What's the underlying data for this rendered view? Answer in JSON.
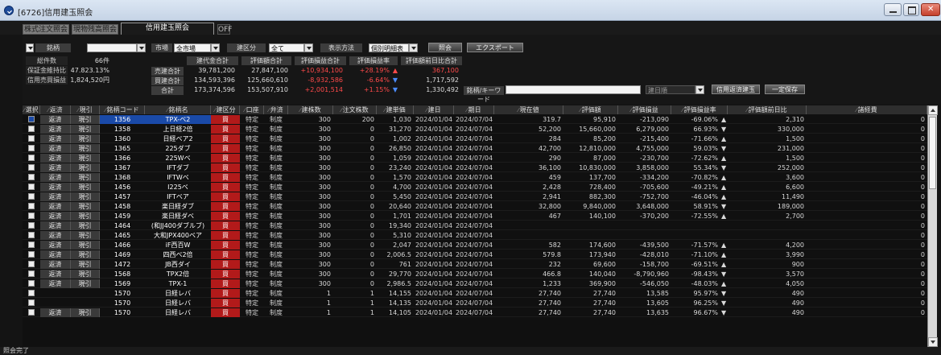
{
  "window": {
    "title": "[6726]信用建玉照会"
  },
  "tabs": [
    {
      "label": "株式注文照会"
    },
    {
      "label": "現物残高照会"
    },
    {
      "label": "信用建玉照会"
    },
    {
      "label": "OFF"
    }
  ],
  "filters": {
    "meigara_label": "銘柄",
    "meigara_value": "",
    "shijo_label": "市場",
    "shijo_value": "全市場",
    "tatekubun_label": "建区分",
    "tatekubun_value": "全て",
    "hyoji_label": "表示方法",
    "hyoji_value": "個別明細表示",
    "shokai_button": "照会",
    "export_button": "エクスポート"
  },
  "summary": {
    "rows": [
      {
        "label": "総件数",
        "value": "66件"
      },
      {
        "label": "保証金維持比率",
        "value": "47.823.13%"
      },
      {
        "label": "信用売買損益",
        "value": "1,824,520円"
      }
    ],
    "headers": [
      "建代金合計",
      "評価額合計",
      "評価損益合計",
      "評価損益率",
      "評価額前日比合計"
    ],
    "lines": [
      {
        "label": "売建合計",
        "values": [
          "39,781,200",
          "27,847,100",
          "+10,934,100",
          "+28.19%",
          "367,100"
        ],
        "arrow": "up"
      },
      {
        "label": "買建合計",
        "values": [
          "134,593,396",
          "125,660,610",
          "-8,932,586",
          "-6.64%",
          "1,717,592"
        ],
        "arrow": "down"
      },
      {
        "label": "合計",
        "values": [
          "173,374,596",
          "153,507,910",
          "+2,001,514",
          "+1.15%",
          "1,330,492"
        ],
        "arrow": "down"
      }
    ],
    "keyword_label": "銘柄/キーワード",
    "keyword_value": "",
    "date_value": "建日順",
    "order_btn": "信用返済建玉",
    "hold_btn": "一定保存"
  },
  "columns": [
    "選択",
    "返済",
    "現引",
    "銘柄コード",
    "銘柄名",
    "建区分",
    "口座",
    "弁済",
    "建株数",
    "注文株数",
    "建単価",
    "建日",
    "期日",
    "現在値",
    "評価額",
    "評価損益",
    "評価損益率",
    "評価額前日比",
    "諸経費"
  ],
  "rows": [
    {
      "sel": true,
      "act1": "返済",
      "act2": "現引",
      "code": "1356",
      "name": "TPX-ベ2",
      "kubun": "買",
      "koza": "特定",
      "bensai": "制度",
      "qty": "300",
      "order": "200",
      "price": "1,030",
      "date": "2024/01/04",
      "due": "2024/07/04",
      "cur": "319.7",
      "eval": "95,910",
      "pl": "-213,090",
      "plr": "-69.06%",
      "arrow": "up",
      "dod": "2,310",
      "fee": "0",
      "neg": true
    },
    {
      "sel": false,
      "act1": "返済",
      "act2": "現引",
      "code": "1358",
      "name": "上日経2倍",
      "kubun": "買",
      "koza": "特定",
      "bensai": "制度",
      "qty": "300",
      "order": "0",
      "price": "31,270",
      "date": "2024/01/04",
      "due": "2024/07/04",
      "cur": "52,200",
      "eval": "15,660,000",
      "pl": "6,279,000",
      "plr": "66.93%",
      "arrow": "down",
      "dod": "330,000",
      "fee": "0",
      "neg": false
    },
    {
      "sel": false,
      "act1": "返済",
      "act2": "現引",
      "code": "1360",
      "name": "日経ベア2",
      "kubun": "買",
      "koza": "特定",
      "bensai": "制度",
      "qty": "300",
      "order": "0",
      "price": "1,002",
      "date": "2024/01/04",
      "due": "2024/07/04",
      "cur": "284",
      "eval": "85,200",
      "pl": "-215,400",
      "plr": "-71.66%",
      "arrow": "up",
      "dod": "1,500",
      "fee": "0",
      "neg": true
    },
    {
      "sel": false,
      "act1": "返済",
      "act2": "現引",
      "code": "1365",
      "name": "225ダブ",
      "kubun": "買",
      "koza": "特定",
      "bensai": "制度",
      "qty": "300",
      "order": "0",
      "price": "26,850",
      "date": "2024/01/04",
      "due": "2024/07/04",
      "cur": "42,700",
      "eval": "12,810,000",
      "pl": "4,755,000",
      "plr": "59.03%",
      "arrow": "down",
      "dod": "231,000",
      "fee": "0",
      "neg": false
    },
    {
      "sel": false,
      "act1": "返済",
      "act2": "現引",
      "code": "1366",
      "name": "225Wベ",
      "kubun": "買",
      "koza": "特定",
      "bensai": "制度",
      "qty": "300",
      "order": "0",
      "price": "1,059",
      "date": "2024/01/04",
      "due": "2024/07/04",
      "cur": "290",
      "eval": "87,000",
      "pl": "-230,700",
      "plr": "-72.62%",
      "arrow": "up",
      "dod": "1,500",
      "fee": "0",
      "neg": true
    },
    {
      "sel": false,
      "act1": "返済",
      "act2": "現引",
      "code": "1367",
      "name": "IFTダブ",
      "kubun": "買",
      "koza": "特定",
      "bensai": "制度",
      "qty": "300",
      "order": "0",
      "price": "23,240",
      "date": "2024/01/04",
      "due": "2024/07/04",
      "cur": "36,100",
      "eval": "10,830,000",
      "pl": "3,858,000",
      "plr": "55.34%",
      "arrow": "down",
      "dod": "252,000",
      "fee": "0",
      "neg": false
    },
    {
      "sel": false,
      "act1": "返済",
      "act2": "現引",
      "code": "1368",
      "name": "IFTWベ",
      "kubun": "買",
      "koza": "特定",
      "bensai": "制度",
      "qty": "300",
      "order": "0",
      "price": "1,570",
      "date": "2024/01/04",
      "due": "2024/07/04",
      "cur": "459",
      "eval": "137,700",
      "pl": "-334,200",
      "plr": "-70.82%",
      "arrow": "up",
      "dod": "3,600",
      "fee": "0",
      "neg": true
    },
    {
      "sel": false,
      "act1": "返済",
      "act2": "現引",
      "code": "1456",
      "name": "I225ベ",
      "kubun": "買",
      "koza": "特定",
      "bensai": "制度",
      "qty": "300",
      "order": "0",
      "price": "4,700",
      "date": "2024/01/04",
      "due": "2024/07/04",
      "cur": "2,428",
      "eval": "728,400",
      "pl": "-705,600",
      "plr": "-49.21%",
      "arrow": "up",
      "dod": "6,600",
      "fee": "0",
      "neg": true
    },
    {
      "sel": false,
      "act1": "返済",
      "act2": "現引",
      "code": "1457",
      "name": "IFTベア",
      "kubun": "買",
      "koza": "特定",
      "bensai": "制度",
      "qty": "300",
      "order": "0",
      "price": "5,450",
      "date": "2024/01/04",
      "due": "2024/07/04",
      "cur": "2,941",
      "eval": "882,300",
      "pl": "-752,700",
      "plr": "-46.04%",
      "arrow": "up",
      "dod": "11,490",
      "fee": "0",
      "neg": true
    },
    {
      "sel": false,
      "act1": "返済",
      "act2": "現引",
      "code": "1458",
      "name": "楽日経ダブ",
      "kubun": "買",
      "koza": "特定",
      "bensai": "制度",
      "qty": "300",
      "order": "0",
      "price": "20,640",
      "date": "2024/01/04",
      "due": "2024/07/04",
      "cur": "32,800",
      "eval": "9,840,000",
      "pl": "3,648,000",
      "plr": "58.91%",
      "arrow": "down",
      "dod": "189,000",
      "fee": "0",
      "neg": false
    },
    {
      "sel": false,
      "act1": "返済",
      "act2": "現引",
      "code": "1459",
      "name": "楽日経ダベ",
      "kubun": "買",
      "koza": "特定",
      "bensai": "制度",
      "qty": "300",
      "order": "0",
      "price": "1,701",
      "date": "2024/01/04",
      "due": "2024/07/04",
      "cur": "467",
      "eval": "140,100",
      "pl": "-370,200",
      "plr": "-72.55%",
      "arrow": "up",
      "dod": "2,700",
      "fee": "0",
      "neg": true
    },
    {
      "sel": false,
      "act1": "返済",
      "act2": "現引",
      "code": "1464",
      "name": "(和JJ400ダブルブ)",
      "kubun": "買",
      "koza": "特定",
      "bensai": "制度",
      "qty": "300",
      "order": "0",
      "price": "19,340",
      "date": "2024/01/04",
      "due": "2024/07/04",
      "cur": "",
      "eval": "",
      "pl": "",
      "plr": "",
      "arrow": "",
      "dod": "",
      "fee": "0",
      "neg": false
    },
    {
      "sel": false,
      "act1": "返済",
      "act2": "現引",
      "code": "1465",
      "name": "大和JPX400ベア",
      "kubun": "買",
      "koza": "特定",
      "bensai": "制度",
      "qty": "300",
      "order": "0",
      "price": "5,310",
      "date": "2024/01/04",
      "due": "2024/07/04",
      "cur": "",
      "eval": "",
      "pl": "",
      "plr": "",
      "arrow": "",
      "dod": "",
      "fee": "0",
      "neg": false
    },
    {
      "sel": false,
      "act1": "返済",
      "act2": "現引",
      "code": "1466",
      "name": "iF西百W",
      "kubun": "買",
      "koza": "特定",
      "bensai": "制度",
      "qty": "300",
      "order": "0",
      "price": "2,047",
      "date": "2024/01/04",
      "due": "2024/07/04",
      "cur": "582",
      "eval": "174,600",
      "pl": "-439,500",
      "plr": "-71.57%",
      "arrow": "up",
      "dod": "4,200",
      "fee": "0",
      "neg": true
    },
    {
      "sel": false,
      "act1": "返済",
      "act2": "現引",
      "code": "1469",
      "name": "四西ベ2倍",
      "kubun": "買",
      "koza": "特定",
      "bensai": "制度",
      "qty": "300",
      "order": "0",
      "price": "2,006.5",
      "date": "2024/01/04",
      "due": "2024/07/04",
      "cur": "579.8",
      "eval": "173,940",
      "pl": "-428,010",
      "plr": "-71.10%",
      "arrow": "up",
      "dod": "3,990",
      "fee": "0",
      "neg": true
    },
    {
      "sel": false,
      "act1": "返済",
      "act2": "現引",
      "code": "1472",
      "name": "JB西ダイ",
      "kubun": "買",
      "koza": "特定",
      "bensai": "制度",
      "qty": "300",
      "order": "0",
      "price": "761",
      "date": "2024/01/04",
      "due": "2024/07/04",
      "cur": "232",
      "eval": "69,600",
      "pl": "-158,700",
      "plr": "-69.51%",
      "arrow": "up",
      "dod": "900",
      "fee": "0",
      "neg": true
    },
    {
      "sel": false,
      "act1": "返済",
      "act2": "現引",
      "code": "1568",
      "name": "TPX2倍",
      "kubun": "買",
      "koza": "特定",
      "bensai": "制度",
      "qty": "300",
      "order": "0",
      "price": "29,770",
      "date": "2024/01/04",
      "due": "2024/07/04",
      "cur": "466.8",
      "eval": "140,040",
      "pl": "-8,790,960",
      "plr": "-98.43%",
      "arrow": "down",
      "dod": "3,570",
      "fee": "0",
      "neg": true
    },
    {
      "sel": false,
      "act1": "返済",
      "act2": "現引",
      "code": "1569",
      "name": "TPX-1",
      "kubun": "買",
      "koza": "特定",
      "bensai": "制度",
      "qty": "300",
      "order": "0",
      "price": "2,986.5",
      "date": "2024/01/04",
      "due": "2024/07/04",
      "cur": "1,233",
      "eval": "369,900",
      "pl": "-546,050",
      "plr": "-48.03%",
      "arrow": "up",
      "dod": "4,050",
      "fee": "0",
      "neg": true
    },
    {
      "sel": false,
      "act1": "",
      "act2": "",
      "code": "1570",
      "name": "日経レバ",
      "kubun": "買",
      "koza": "特定",
      "bensai": "制度",
      "qty": "1",
      "order": "1",
      "price": "14,155",
      "date": "2024/01/04",
      "due": "2024/07/04",
      "cur": "27,740",
      "eval": "27,740",
      "pl": "13,585",
      "plr": "95.97%",
      "arrow": "down",
      "dod": "490",
      "fee": "0",
      "neg": false
    },
    {
      "sel": false,
      "act1": "",
      "act2": "",
      "code": "1570",
      "name": "日経レバ",
      "kubun": "買",
      "koza": "特定",
      "bensai": "制度",
      "qty": "1",
      "order": "1",
      "price": "14,135",
      "date": "2024/01/04",
      "due": "2024/07/04",
      "cur": "27,740",
      "eval": "27,740",
      "pl": "13,605",
      "plr": "96.25%",
      "arrow": "down",
      "dod": "490",
      "fee": "0",
      "neg": false
    },
    {
      "sel": false,
      "act1": "返済",
      "act2": "現引",
      "code": "1570",
      "name": "日経レバ",
      "kubun": "買",
      "koza": "特定",
      "bensai": "制度",
      "qty": "1",
      "order": "1",
      "price": "14,105",
      "date": "2024/01/04",
      "due": "2024/07/04",
      "cur": "27,740",
      "eval": "27,740",
      "pl": "13,635",
      "plr": "96.67%",
      "arrow": "down",
      "dod": "490",
      "fee": "0",
      "neg": false
    }
  ],
  "status": "照会完了",
  "colors": {
    "accent": "#1a4aa8",
    "neg": "#ff4a4a",
    "down": "#4b8cff",
    "kubun": "#b21a1a"
  }
}
